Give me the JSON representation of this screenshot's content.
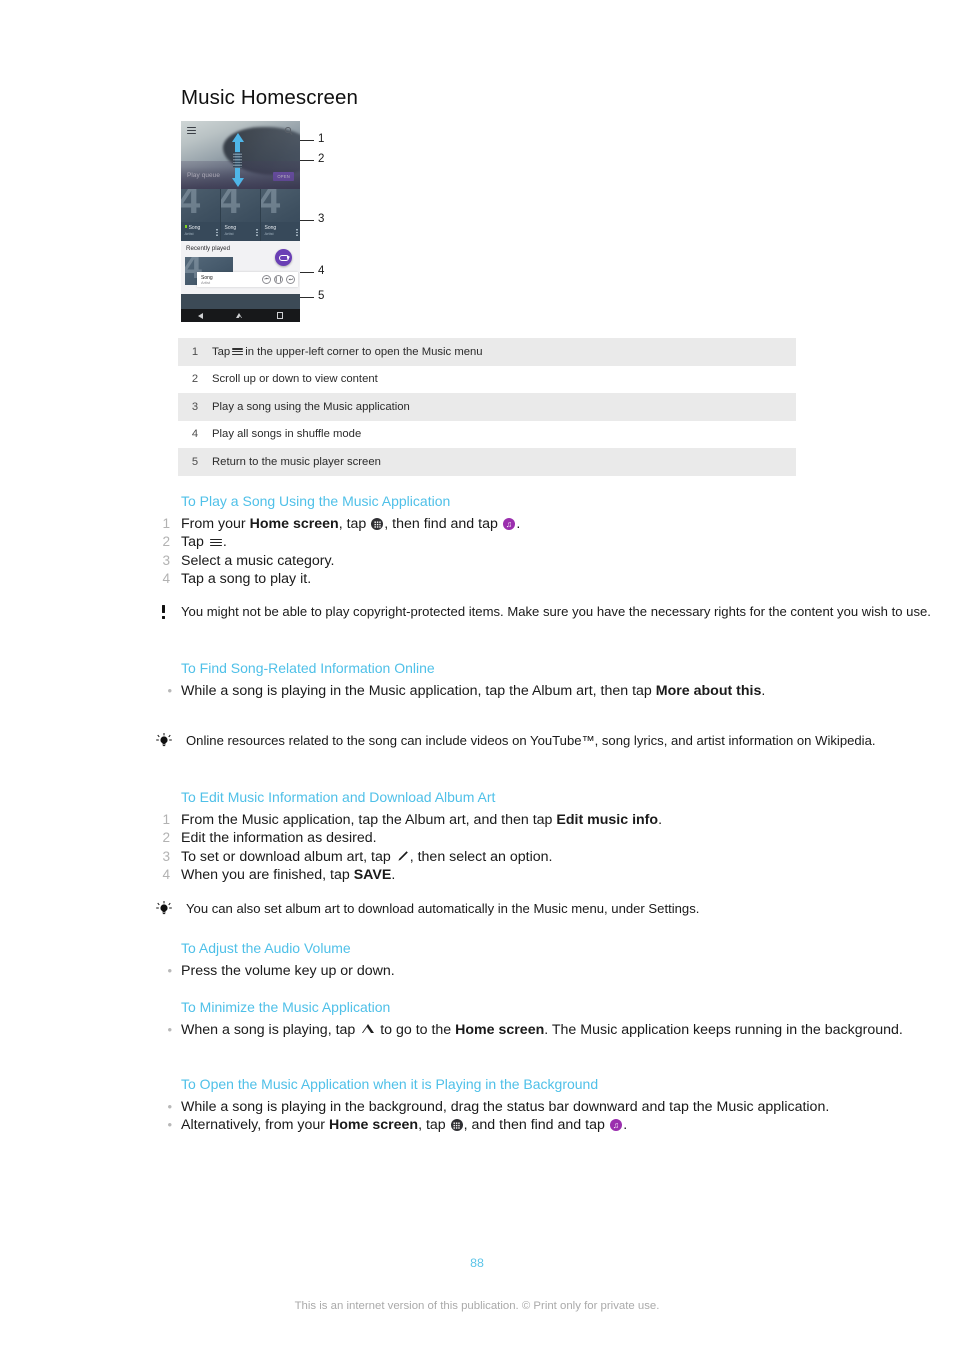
{
  "document": {
    "title": "Music Homescreen",
    "page_number": "88",
    "disclaimer": "This is an internet version of this publication. © Print only for private use.",
    "heading_color": "#4fc0e8",
    "accent_purple": "#9b2fae",
    "arrow_blue": "#4fb6e8"
  },
  "figure": {
    "screenshot_name": "music-homescreen-phone-screenshot",
    "top_bar": {
      "menu_icon": "hamburger-menu-icon",
      "search_icon": "search-icon"
    },
    "play_queue": {
      "label": "Play queue",
      "open_button": "OPEN"
    },
    "albums": [
      {
        "title": "Song",
        "artist": "Artist",
        "playing": true
      },
      {
        "title": "Song",
        "artist": "Artist",
        "playing": false
      },
      {
        "title": "Song",
        "artist": "Artist",
        "playing": false
      }
    ],
    "recently_played": {
      "label": "Recently played",
      "shuffle_fab": "shuffle-icon"
    },
    "mini_player": {
      "title": "Song",
      "artist": "Artist",
      "previous": "⏮",
      "pause": "❙❙",
      "next": "⏭"
    },
    "nav_bar": {
      "back": "back-icon",
      "home": "home-icon",
      "recents": "recents-icon"
    },
    "callouts": [
      "1",
      "2",
      "3",
      "4",
      "5"
    ]
  },
  "legend": {
    "rows": [
      {
        "num": "1",
        "pre": "Tap",
        "post": "in the upper-left corner to open the Music menu",
        "has_icon": true
      },
      {
        "num": "2",
        "pre": "Scroll up or down to view content",
        "post": "",
        "has_icon": false
      },
      {
        "num": "3",
        "pre": "Play a song using the Music application",
        "post": "",
        "has_icon": false
      },
      {
        "num": "4",
        "pre": "Play all songs in shuffle mode",
        "post": "",
        "has_icon": false
      },
      {
        "num": "5",
        "pre": "Return to the music player screen",
        "post": "",
        "has_icon": false
      }
    ]
  },
  "sections": {
    "play_song": {
      "heading": "To Play a Song Using the Music Application",
      "steps": {
        "s1a": "From your ",
        "s1b": "Home screen",
        "s1c": ", tap ",
        "s1d": ", then find and tap ",
        "s1e": ".",
        "s2a": "Tap ",
        "s2b": ".",
        "s3": "Select a music category.",
        "s4": "Tap a song to play it."
      },
      "markers": [
        "1",
        "2",
        "3",
        "4"
      ],
      "warning": "You might not be able to play copyright-protected items. Make sure you have the necessary rights for the content you wish to use."
    },
    "find_info": {
      "heading": "To Find Song-Related Information Online",
      "bullet_marker": "•",
      "bullet_a": "While a song is playing in the Music application, tap the Album art, then tap ",
      "bullet_b": "More about this",
      "bullet_c": ".",
      "tip": "Online resources related to the song can include videos on YouTube™, song lyrics, and artist information on Wikipedia."
    },
    "edit_info": {
      "heading": "To Edit Music Information and Download Album Art",
      "markers": [
        "1",
        "2",
        "3",
        "4"
      ],
      "s1a": "From the Music application, tap the Album art, and then tap ",
      "s1b": "Edit music info",
      "s1c": ".",
      "s2": "Edit the information as desired.",
      "s3a": "To set or download album art, tap ",
      "s3b": ", then select an option.",
      "s4a": "When you are finished, tap ",
      "s4b": "SAVE",
      "s4c": ".",
      "tip": "You can also set album art to download automatically in the Music menu, under Settings."
    },
    "adjust_volume": {
      "heading": "To Adjust the Audio Volume",
      "bullet_marker": "•",
      "bullet": "Press the volume key up or down."
    },
    "minimize": {
      "heading": "To Minimize the Music Application",
      "bullet_marker": "•",
      "b_a": "When a song is playing, tap ",
      "b_b": " to go to the ",
      "b_c": "Home screen",
      "b_d": ". The Music application keeps running in the background."
    },
    "open_background": {
      "heading": "To Open the Music Application when it is Playing in the Background",
      "bullet_marker": "•",
      "b1": "While a song is playing in the background, drag the status bar downward and tap the Music application.",
      "b2a": "Alternatively, from your ",
      "b2b": "Home screen",
      "b2c": ", tap ",
      "b2d": ", and then find and tap ",
      "b2e": "."
    }
  }
}
